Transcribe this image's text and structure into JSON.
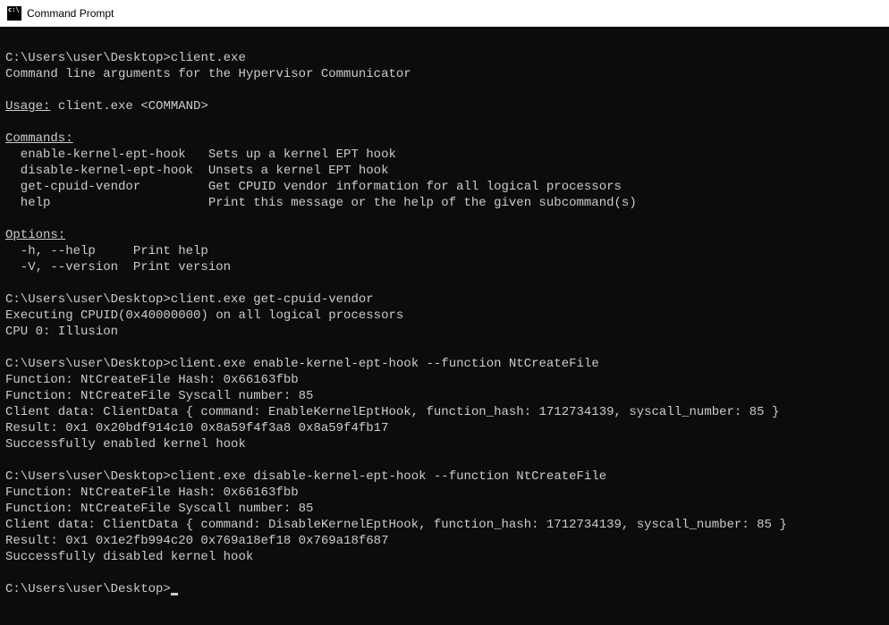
{
  "window": {
    "title": "Command Prompt"
  },
  "terminal": {
    "prompt": "C:\\Users\\user\\Desktop>",
    "blank": "",
    "cmd1": "client.exe",
    "out1_l1": "Command line arguments for the Hypervisor Communicator",
    "out1_usage_label": "Usage:",
    "out1_usage_rest": " client.exe <COMMAND>",
    "out1_commands_label": "Commands:",
    "out1_c1": "  enable-kernel-ept-hook   Sets up a kernel EPT hook",
    "out1_c2": "  disable-kernel-ept-hook  Unsets a kernel EPT hook",
    "out1_c3": "  get-cpuid-vendor         Get CPUID vendor information for all logical processors",
    "out1_c4": "  help                     Print this message or the help of the given subcommand(s)",
    "out1_options_label": "Options:",
    "out1_o1": "  -h, --help     Print help",
    "out1_o2": "  -V, --version  Print version",
    "cmd2": "client.exe get-cpuid-vendor",
    "out2_l1": "Executing CPUID(0x40000000) on all logical processors",
    "out2_l2": "CPU 0: Illusion",
    "cmd3": "client.exe enable-kernel-ept-hook --function NtCreateFile",
    "out3_l1": "Function: NtCreateFile Hash: 0x66163fbb",
    "out3_l2": "Function: NtCreateFile Syscall number: 85",
    "out3_l3": "Client data: ClientData { command: EnableKernelEptHook, function_hash: 1712734139, syscall_number: 85 }",
    "out3_l4": "Result: 0x1 0x20bdf914c10 0x8a59f4f3a8 0x8a59f4fb17",
    "out3_l5": "Successfully enabled kernel hook",
    "cmd4": "client.exe disable-kernel-ept-hook --function NtCreateFile",
    "out4_l1": "Function: NtCreateFile Hash: 0x66163fbb",
    "out4_l2": "Function: NtCreateFile Syscall number: 85",
    "out4_l3": "Client data: ClientData { command: DisableKernelEptHook, function_hash: 1712734139, syscall_number: 85 }",
    "out4_l4": "Result: 0x1 0x1e2fb994c20 0x769a18ef18 0x769a18f687",
    "out4_l5": "Successfully disabled kernel hook"
  }
}
